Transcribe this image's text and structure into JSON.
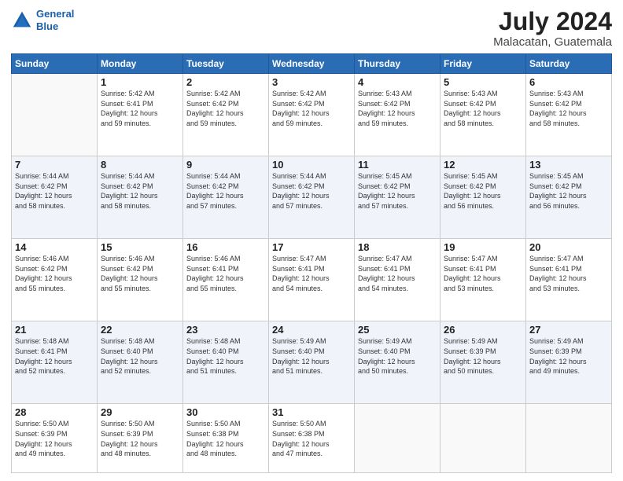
{
  "header": {
    "logo_line1": "General",
    "logo_line2": "Blue",
    "month_year": "July 2024",
    "location": "Malacatan, Guatemala"
  },
  "days_of_week": [
    "Sunday",
    "Monday",
    "Tuesday",
    "Wednesday",
    "Thursday",
    "Friday",
    "Saturday"
  ],
  "weeks": [
    [
      {
        "num": "",
        "info": ""
      },
      {
        "num": "1",
        "info": "Sunrise: 5:42 AM\nSunset: 6:41 PM\nDaylight: 12 hours\nand 59 minutes."
      },
      {
        "num": "2",
        "info": "Sunrise: 5:42 AM\nSunset: 6:42 PM\nDaylight: 12 hours\nand 59 minutes."
      },
      {
        "num": "3",
        "info": "Sunrise: 5:42 AM\nSunset: 6:42 PM\nDaylight: 12 hours\nand 59 minutes."
      },
      {
        "num": "4",
        "info": "Sunrise: 5:43 AM\nSunset: 6:42 PM\nDaylight: 12 hours\nand 59 minutes."
      },
      {
        "num": "5",
        "info": "Sunrise: 5:43 AM\nSunset: 6:42 PM\nDaylight: 12 hours\nand 58 minutes."
      },
      {
        "num": "6",
        "info": "Sunrise: 5:43 AM\nSunset: 6:42 PM\nDaylight: 12 hours\nand 58 minutes."
      }
    ],
    [
      {
        "num": "7",
        "info": "Sunrise: 5:44 AM\nSunset: 6:42 PM\nDaylight: 12 hours\nand 58 minutes."
      },
      {
        "num": "8",
        "info": "Sunrise: 5:44 AM\nSunset: 6:42 PM\nDaylight: 12 hours\nand 58 minutes."
      },
      {
        "num": "9",
        "info": "Sunrise: 5:44 AM\nSunset: 6:42 PM\nDaylight: 12 hours\nand 57 minutes."
      },
      {
        "num": "10",
        "info": "Sunrise: 5:44 AM\nSunset: 6:42 PM\nDaylight: 12 hours\nand 57 minutes."
      },
      {
        "num": "11",
        "info": "Sunrise: 5:45 AM\nSunset: 6:42 PM\nDaylight: 12 hours\nand 57 minutes."
      },
      {
        "num": "12",
        "info": "Sunrise: 5:45 AM\nSunset: 6:42 PM\nDaylight: 12 hours\nand 56 minutes."
      },
      {
        "num": "13",
        "info": "Sunrise: 5:45 AM\nSunset: 6:42 PM\nDaylight: 12 hours\nand 56 minutes."
      }
    ],
    [
      {
        "num": "14",
        "info": "Sunrise: 5:46 AM\nSunset: 6:42 PM\nDaylight: 12 hours\nand 55 minutes."
      },
      {
        "num": "15",
        "info": "Sunrise: 5:46 AM\nSunset: 6:42 PM\nDaylight: 12 hours\nand 55 minutes."
      },
      {
        "num": "16",
        "info": "Sunrise: 5:46 AM\nSunset: 6:41 PM\nDaylight: 12 hours\nand 55 minutes."
      },
      {
        "num": "17",
        "info": "Sunrise: 5:47 AM\nSunset: 6:41 PM\nDaylight: 12 hours\nand 54 minutes."
      },
      {
        "num": "18",
        "info": "Sunrise: 5:47 AM\nSunset: 6:41 PM\nDaylight: 12 hours\nand 54 minutes."
      },
      {
        "num": "19",
        "info": "Sunrise: 5:47 AM\nSunset: 6:41 PM\nDaylight: 12 hours\nand 53 minutes."
      },
      {
        "num": "20",
        "info": "Sunrise: 5:47 AM\nSunset: 6:41 PM\nDaylight: 12 hours\nand 53 minutes."
      }
    ],
    [
      {
        "num": "21",
        "info": "Sunrise: 5:48 AM\nSunset: 6:41 PM\nDaylight: 12 hours\nand 52 minutes."
      },
      {
        "num": "22",
        "info": "Sunrise: 5:48 AM\nSunset: 6:40 PM\nDaylight: 12 hours\nand 52 minutes."
      },
      {
        "num": "23",
        "info": "Sunrise: 5:48 AM\nSunset: 6:40 PM\nDaylight: 12 hours\nand 51 minutes."
      },
      {
        "num": "24",
        "info": "Sunrise: 5:49 AM\nSunset: 6:40 PM\nDaylight: 12 hours\nand 51 minutes."
      },
      {
        "num": "25",
        "info": "Sunrise: 5:49 AM\nSunset: 6:40 PM\nDaylight: 12 hours\nand 50 minutes."
      },
      {
        "num": "26",
        "info": "Sunrise: 5:49 AM\nSunset: 6:39 PM\nDaylight: 12 hours\nand 50 minutes."
      },
      {
        "num": "27",
        "info": "Sunrise: 5:49 AM\nSunset: 6:39 PM\nDaylight: 12 hours\nand 49 minutes."
      }
    ],
    [
      {
        "num": "28",
        "info": "Sunrise: 5:50 AM\nSunset: 6:39 PM\nDaylight: 12 hours\nand 49 minutes."
      },
      {
        "num": "29",
        "info": "Sunrise: 5:50 AM\nSunset: 6:39 PM\nDaylight: 12 hours\nand 48 minutes."
      },
      {
        "num": "30",
        "info": "Sunrise: 5:50 AM\nSunset: 6:38 PM\nDaylight: 12 hours\nand 48 minutes."
      },
      {
        "num": "31",
        "info": "Sunrise: 5:50 AM\nSunset: 6:38 PM\nDaylight: 12 hours\nand 47 minutes."
      },
      {
        "num": "",
        "info": ""
      },
      {
        "num": "",
        "info": ""
      },
      {
        "num": "",
        "info": ""
      }
    ]
  ]
}
